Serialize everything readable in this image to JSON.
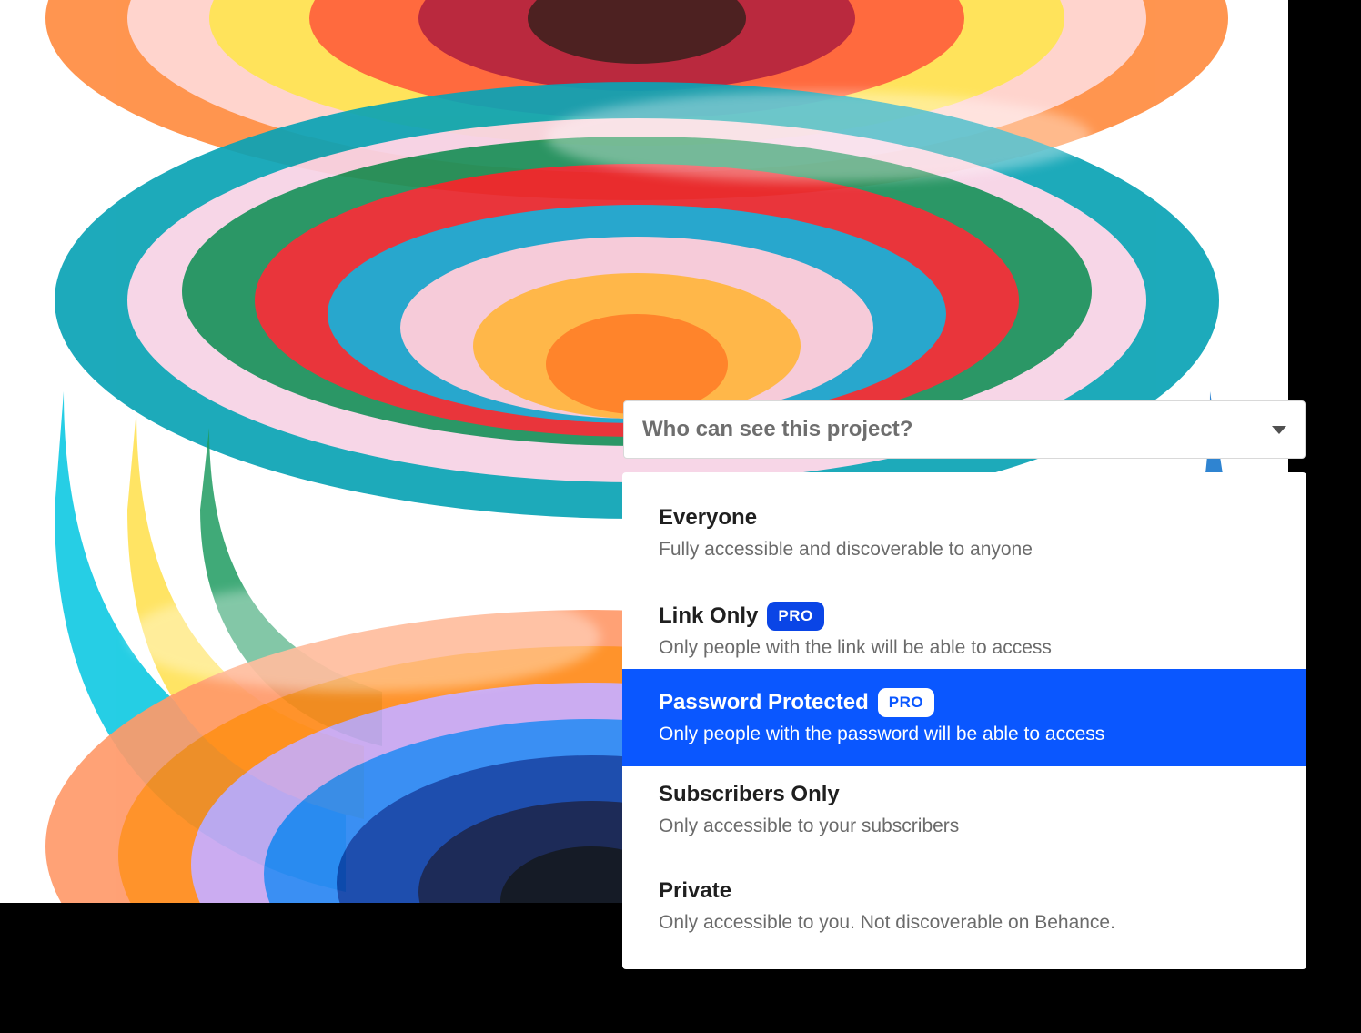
{
  "visibility": {
    "question": "Who can see this project?",
    "options": [
      {
        "title": "Everyone",
        "description": "Fully accessible and discoverable to anyone",
        "badge": ""
      },
      {
        "title": "Link Only",
        "description": "Only people with the link will be able to access",
        "badge": "PRO"
      },
      {
        "title": "Password Protected",
        "description": "Only people with the password will be able to access",
        "badge": "PRO",
        "selected": true
      },
      {
        "title": "Subscribers Only",
        "description": "Only accessible to your subscribers",
        "badge": ""
      },
      {
        "title": "Private",
        "description": "Only accessible to you. Not discoverable on Behance.",
        "badge": ""
      }
    ]
  },
  "colors": {
    "selected_background": "#0a57ff",
    "badge_background": "#0a45e6",
    "backdrop": "#000000"
  },
  "icons": {
    "dropdown": "caret-down-icon"
  }
}
